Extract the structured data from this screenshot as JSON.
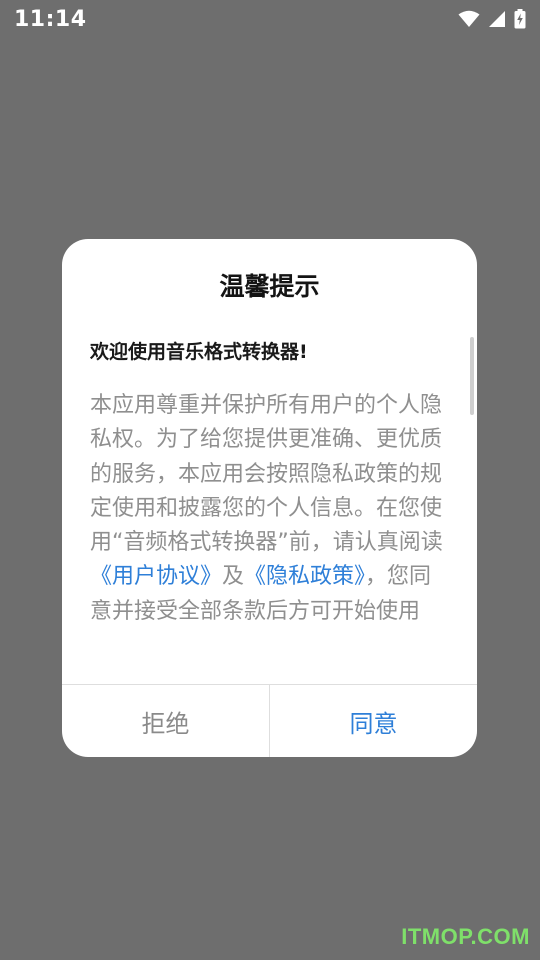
{
  "status_bar": {
    "time": "11:14",
    "icons": [
      "wifi-icon",
      "signal-icon",
      "battery-charging-icon"
    ]
  },
  "dialog": {
    "title": "温馨提示",
    "welcome": "欢迎使用音乐格式转换器!",
    "body_part1": "本应用尊重并保护所有用户的个人隐私权。为了给您提供更准确、更优质的服务，本应用会按照隐私政策的规定使用和披露您的个人信息。在您使用“音频格式转换器”前，请认真阅读",
    "link_user_agreement": "《用户协议》",
    "body_and": "及",
    "link_privacy_policy": "《隐私政策》",
    "body_part2": "，您同意并接受全部条款后方可开始使用",
    "reject_label": "拒绝",
    "agree_label": "同意"
  },
  "colors": {
    "overlay": "#6e6e6e",
    "link": "#2e7fd8",
    "reject_text": "#8a8a8a"
  },
  "watermark": "ITMOP.COM"
}
